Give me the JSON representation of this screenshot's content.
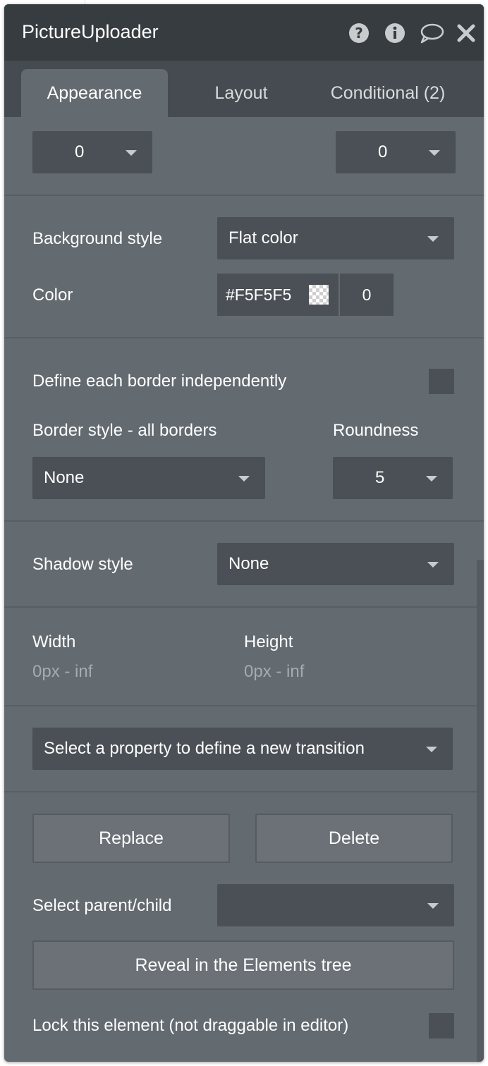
{
  "panel": {
    "title": "PictureUploader",
    "icons": [
      "help-icon",
      "info-icon",
      "comment-icon",
      "close-icon"
    ]
  },
  "tabs": [
    {
      "label": "Appearance",
      "active": true
    },
    {
      "label": "Layout",
      "active": false
    },
    {
      "label": "Conditional (2)",
      "active": false
    }
  ],
  "top_dropdowns": {
    "left_value": "0",
    "right_value": "0"
  },
  "background": {
    "style_label": "Background style",
    "style_value": "Flat color",
    "color_label": "Color",
    "color_hex": "#F5F5F5",
    "color_opacity": "0"
  },
  "border": {
    "independent_label": "Define each border independently",
    "independent_checked": false,
    "style_label": "Border style - all borders",
    "style_value": "None",
    "roundness_label": "Roundness",
    "roundness_value": "5"
  },
  "shadow": {
    "label": "Shadow style",
    "value": "None"
  },
  "size": {
    "width_label": "Width",
    "width_value": "0px - inf",
    "height_label": "Height",
    "height_value": "0px - inf"
  },
  "transition": {
    "placeholder": "Select a property to define a new transition"
  },
  "actions": {
    "replace_label": "Replace",
    "delete_label": "Delete",
    "parent_child_label": "Select parent/child",
    "parent_child_value": "",
    "reveal_label": "Reveal in the Elements tree",
    "lock_label": "Lock this element (not draggable in editor)",
    "lock_checked": false
  },
  "colors": {
    "header_bg": "#363c40",
    "tab_bar_bg": "#454b50",
    "panel_bg": "#636a70",
    "field_bg": "#4a5055"
  }
}
